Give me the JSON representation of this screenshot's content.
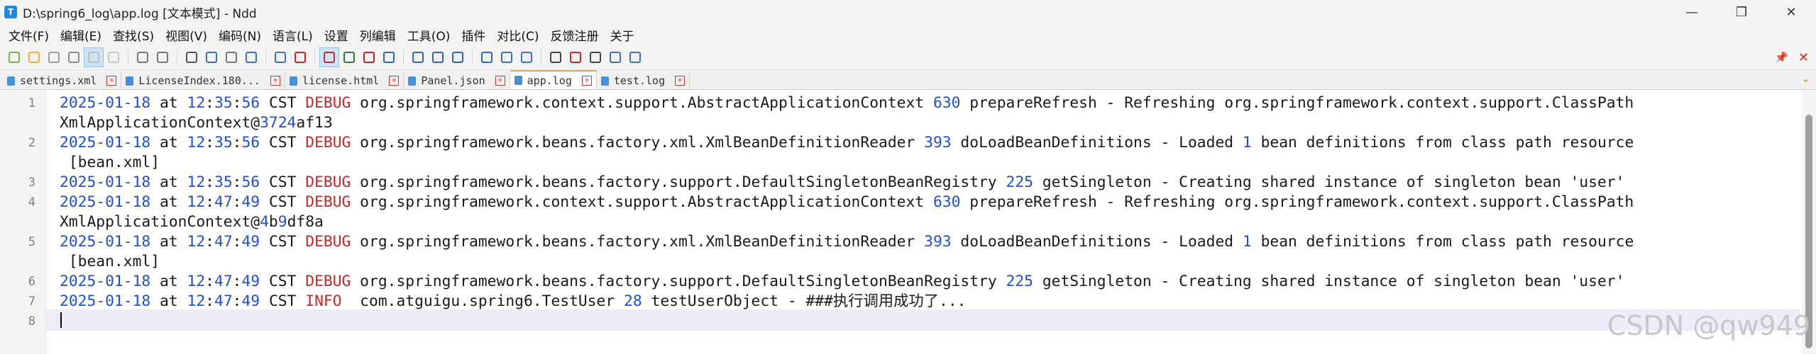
{
  "window": {
    "icon_letter": "T",
    "title": "D:\\spring6_log\\app.log [文本模式] - Ndd",
    "minimize_glyph": "—",
    "maximize_glyph": "❐",
    "close_glyph": "✕"
  },
  "menu": [
    "文件(F)",
    "编辑(E)",
    "查找(S)",
    "视图(V)",
    "编码(N)",
    "语言(L)",
    "设置",
    "列编辑",
    "工具(O)",
    "插件",
    "对比(C)",
    "反馈注册",
    "关于"
  ],
  "toolbar": {
    "icons": [
      "new-file-icon",
      "open-file-icon",
      "save-icon",
      "save-all-icon",
      "close-file-icon",
      "close-all-icon",
      "undo-icon",
      "redo-icon",
      "cut-icon",
      "copy-icon",
      "paste-icon",
      "find-icon",
      "replace-icon",
      "goto-icon",
      "wrap-icon",
      "show-symbols-icon",
      "indent-guide-icon",
      "settings-icon",
      "zoom-in-icon",
      "zoom-out-icon",
      "sync-icon",
      "compare-file-icon",
      "compare-dir-icon",
      "bin-compare-icon",
      "record-macro-icon",
      "stop-macro-icon",
      "play-macro-icon",
      "run-macro-icon",
      "save-macro-icon"
    ],
    "pin_glyph": "📌",
    "close_glyph": "✕"
  },
  "tabs": [
    {
      "label": "settings.xml",
      "active": false
    },
    {
      "label": "LicenseIndex.180...",
      "active": false
    },
    {
      "label": "license.html",
      "active": false
    },
    {
      "label": "Panel.json",
      "active": false
    },
    {
      "label": "app.log",
      "active": true
    },
    {
      "label": "test.log",
      "active": false
    }
  ],
  "tab_close_glyph": "✕",
  "tab_scroll_glyph": "⌄",
  "editor": {
    "lines": [
      {
        "n": "1",
        "segs": [
          [
            "2025-01-18",
            "num"
          ],
          [
            " at ",
            ""
          ],
          [
            "12",
            "num"
          ],
          [
            ":",
            ""
          ],
          [
            "35",
            "num"
          ],
          [
            ":",
            ""
          ],
          [
            "56",
            "num"
          ],
          [
            " CST ",
            ""
          ],
          [
            "DEBUG",
            "lvl"
          ],
          [
            " org.springframework.context.support.AbstractApplicationContext ",
            ""
          ],
          [
            "630",
            "num"
          ],
          [
            " prepareRefresh - Refreshing org.springframework.context.support.ClassPath",
            ""
          ]
        ]
      },
      {
        "n": "",
        "segs": [
          [
            "XmlApplicationContext@",
            ""
          ],
          [
            "3724",
            "num"
          ],
          [
            "af13",
            ""
          ]
        ]
      },
      {
        "n": "2",
        "segs": [
          [
            "2025-01-18",
            "num"
          ],
          [
            " at ",
            ""
          ],
          [
            "12",
            "num"
          ],
          [
            ":",
            ""
          ],
          [
            "35",
            "num"
          ],
          [
            ":",
            ""
          ],
          [
            "56",
            "num"
          ],
          [
            " CST ",
            ""
          ],
          [
            "DEBUG",
            "lvl"
          ],
          [
            " org.springframework.beans.factory.xml.XmlBeanDefinitionReader ",
            ""
          ],
          [
            "393",
            "num"
          ],
          [
            " doLoadBeanDefinitions - Loaded ",
            ""
          ],
          [
            "1",
            "num"
          ],
          [
            " bean definitions from class path resource",
            ""
          ]
        ]
      },
      {
        "n": "",
        "segs": [
          [
            " [bean.xml]",
            ""
          ]
        ]
      },
      {
        "n": "3",
        "segs": [
          [
            "2025-01-18",
            "num"
          ],
          [
            " at ",
            ""
          ],
          [
            "12",
            "num"
          ],
          [
            ":",
            ""
          ],
          [
            "35",
            "num"
          ],
          [
            ":",
            ""
          ],
          [
            "56",
            "num"
          ],
          [
            " CST ",
            ""
          ],
          [
            "DEBUG",
            "lvl"
          ],
          [
            " org.springframework.beans.factory.support.DefaultSingletonBeanRegistry ",
            ""
          ],
          [
            "225",
            "num"
          ],
          [
            " getSingleton - Creating shared instance of singleton bean 'user'",
            ""
          ]
        ]
      },
      {
        "n": "4",
        "segs": [
          [
            "2025-01-18",
            "num"
          ],
          [
            " at ",
            ""
          ],
          [
            "12",
            "num"
          ],
          [
            ":",
            ""
          ],
          [
            "47",
            "num"
          ],
          [
            ":",
            ""
          ],
          [
            "49",
            "num"
          ],
          [
            " CST ",
            ""
          ],
          [
            "DEBUG",
            "lvl"
          ],
          [
            " org.springframework.context.support.AbstractApplicationContext ",
            ""
          ],
          [
            "630",
            "num"
          ],
          [
            " prepareRefresh - Refreshing org.springframework.context.support.ClassPath",
            ""
          ]
        ]
      },
      {
        "n": "",
        "segs": [
          [
            "XmlApplicationContext@",
            ""
          ],
          [
            "4",
            "num"
          ],
          [
            "b",
            ""
          ],
          [
            "9",
            "num"
          ],
          [
            "df8a",
            ""
          ]
        ]
      },
      {
        "n": "5",
        "segs": [
          [
            "2025-01-18",
            "num"
          ],
          [
            " at ",
            ""
          ],
          [
            "12",
            "num"
          ],
          [
            ":",
            ""
          ],
          [
            "47",
            "num"
          ],
          [
            ":",
            ""
          ],
          [
            "49",
            "num"
          ],
          [
            " CST ",
            ""
          ],
          [
            "DEBUG",
            "lvl"
          ],
          [
            " org.springframework.beans.factory.xml.XmlBeanDefinitionReader ",
            ""
          ],
          [
            "393",
            "num"
          ],
          [
            " doLoadBeanDefinitions - Loaded ",
            ""
          ],
          [
            "1",
            "num"
          ],
          [
            " bean definitions from class path resource",
            ""
          ]
        ]
      },
      {
        "n": "",
        "segs": [
          [
            " [bean.xml]",
            ""
          ]
        ]
      },
      {
        "n": "6",
        "segs": [
          [
            "2025-01-18",
            "num"
          ],
          [
            " at ",
            ""
          ],
          [
            "12",
            "num"
          ],
          [
            ":",
            ""
          ],
          [
            "47",
            "num"
          ],
          [
            ":",
            ""
          ],
          [
            "49",
            "num"
          ],
          [
            " CST ",
            ""
          ],
          [
            "DEBUG",
            "lvl"
          ],
          [
            " org.springframework.beans.factory.support.DefaultSingletonBeanRegistry ",
            ""
          ],
          [
            "225",
            "num"
          ],
          [
            " getSingleton - Creating shared instance of singleton bean 'user'",
            ""
          ]
        ]
      },
      {
        "n": "7",
        "segs": [
          [
            "2025-01-18",
            "num"
          ],
          [
            " at ",
            ""
          ],
          [
            "12",
            "num"
          ],
          [
            ":",
            ""
          ],
          [
            "47",
            "num"
          ],
          [
            ":",
            ""
          ],
          [
            "49",
            "num"
          ],
          [
            " CST ",
            ""
          ],
          [
            "INFO ",
            "lvl"
          ],
          [
            " com.atguigu.spring6.TestUser ",
            ""
          ],
          [
            "28",
            "num"
          ],
          [
            " testUserObject - ###执行调用成功了...",
            ""
          ]
        ]
      },
      {
        "n": "8",
        "segs": [
          [
            "",
            ""
          ]
        ]
      }
    ]
  },
  "watermark": "CSDN @qw949"
}
